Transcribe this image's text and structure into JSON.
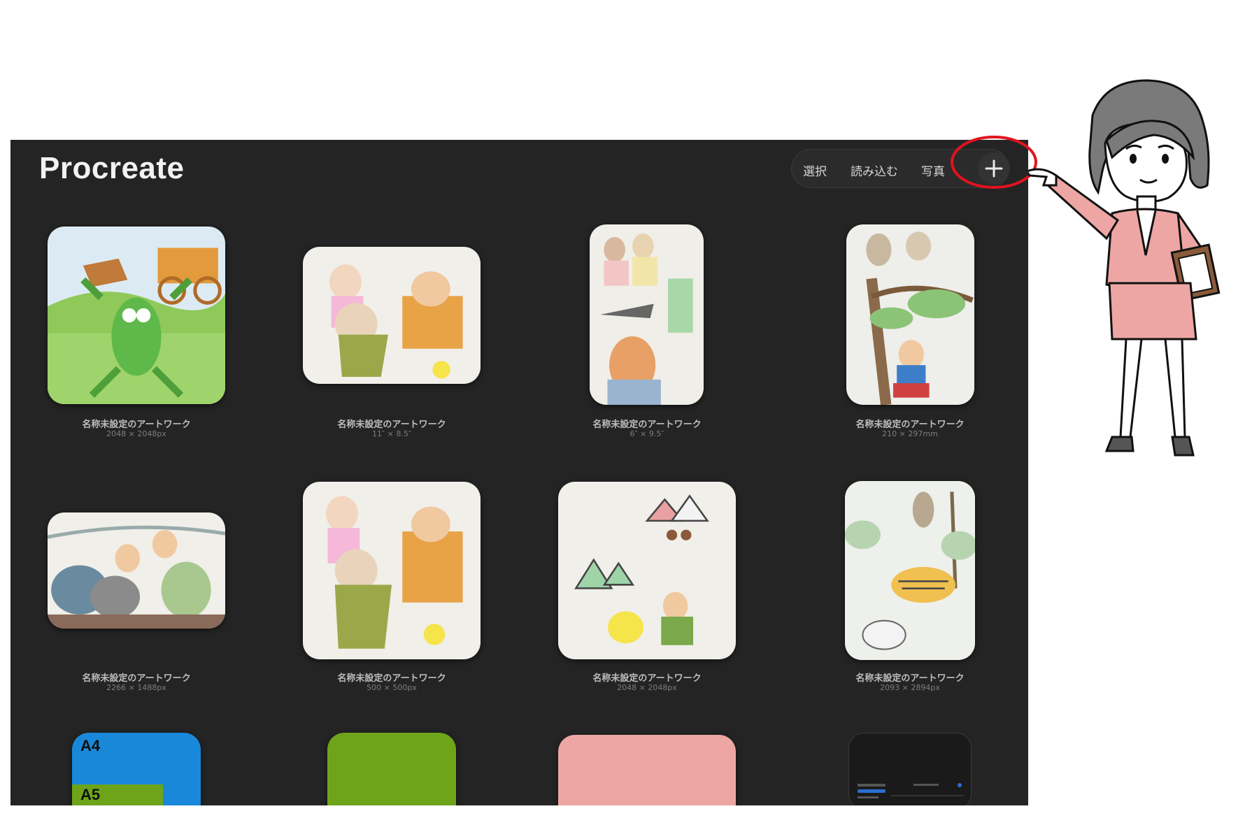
{
  "app": {
    "title": "Procreate"
  },
  "toolbar": {
    "select_label": "選択",
    "import_label": "読み込む",
    "photo_label": "写真",
    "new_button": "plus-icon"
  },
  "gallery": {
    "items": [
      {
        "name": "名称未設定のアートワーク",
        "dims": "2048 × 2048px"
      },
      {
        "name": "名称未設定のアートワーク",
        "dims": "11″ × 8.5″"
      },
      {
        "name": "名称未設定のアートワーク",
        "dims": "6″ × 9.5″"
      },
      {
        "name": "名称未設定のアートワーク",
        "dims": "210 × 297mm"
      },
      {
        "name": "名称未設定のアートワーク",
        "dims": "2266 × 1488px"
      },
      {
        "name": "名称未設定のアートワーク",
        "dims": "500 × 500px"
      },
      {
        "name": "名称未設定のアートワーク",
        "dims": "2048 × 2048px"
      },
      {
        "name": "名称未設定のアートワーク",
        "dims": "2093 × 2894px"
      }
    ],
    "partial_row": {
      "a4_label": "A4",
      "a5_label": "A5"
    }
  },
  "colors": {
    "background": "#242424",
    "highlight": "#e0141e",
    "green": "#6ea41a",
    "pink": "#eda6a4",
    "blue": "#1a88d8"
  }
}
